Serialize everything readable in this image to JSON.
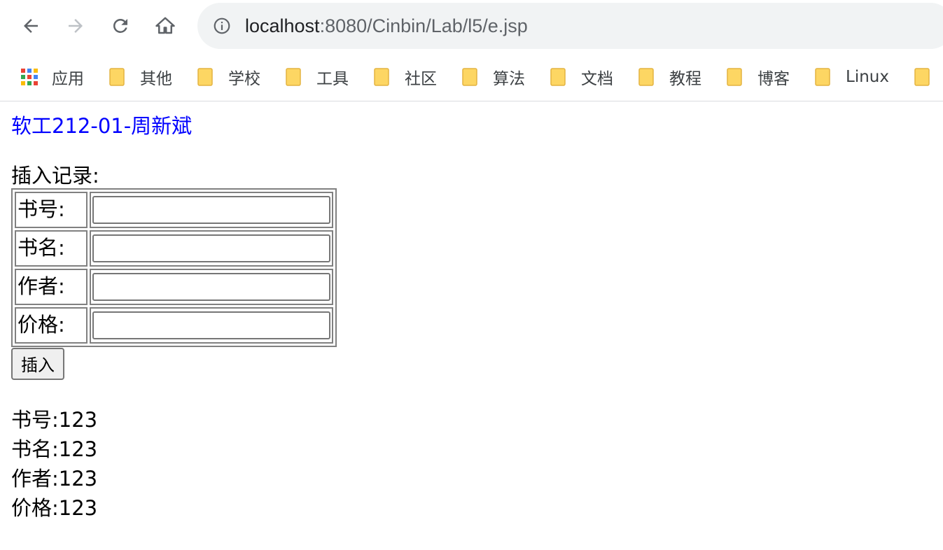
{
  "browser": {
    "url_host": "localhost",
    "url_path": ":8080/Cinbin/Lab/l5/e.jsp"
  },
  "bookmarks": {
    "apps_label": "应用",
    "folders": [
      "其他",
      "学校",
      "工具",
      "社区",
      "算法",
      "文档",
      "教程",
      "博客",
      "Linux"
    ]
  },
  "page": {
    "signature": "软工212-01-周新斌",
    "insert_heading": "插入记录:",
    "form": {
      "fields": [
        {
          "label": "书号:",
          "value": ""
        },
        {
          "label": "书名:",
          "value": ""
        },
        {
          "label": "作者:",
          "value": ""
        },
        {
          "label": "价格:",
          "value": ""
        }
      ],
      "submit_label": "插入"
    },
    "results": [
      "书号:123",
      "书名:123",
      "作者:123",
      "价格:123"
    ]
  },
  "colors": {
    "signature": "#0000ff",
    "folder_icon": "#fdd663"
  }
}
